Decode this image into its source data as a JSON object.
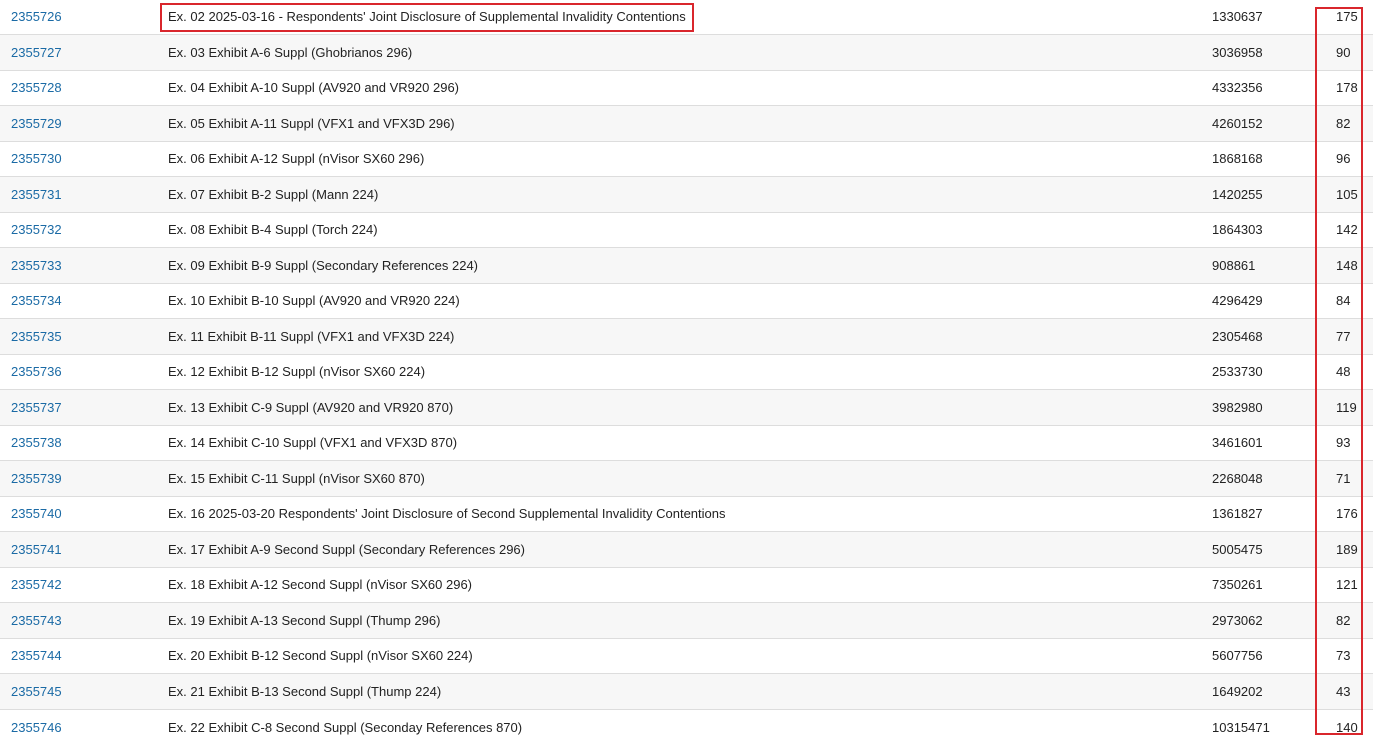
{
  "table": {
    "rows": [
      {
        "id": "2355726",
        "description": "Ex. 02 2025-03-16 - Respondents' Joint Disclosure of Supplemental Invalidity Contentions",
        "size": "1330637",
        "pages": "175"
      },
      {
        "id": "2355727",
        "description": "Ex. 03 Exhibit A-6 Suppl (Ghobrianos 296)",
        "size": "3036958",
        "pages": "90"
      },
      {
        "id": "2355728",
        "description": "Ex. 04 Exhibit A-10 Suppl (AV920 and VR920 296)",
        "size": "4332356",
        "pages": "178"
      },
      {
        "id": "2355729",
        "description": "Ex. 05 Exhibit A-11 Suppl (VFX1 and VFX3D 296)",
        "size": "4260152",
        "pages": "82"
      },
      {
        "id": "2355730",
        "description": "Ex. 06 Exhibit A-12 Suppl (nVisor SX60 296)",
        "size": "1868168",
        "pages": "96"
      },
      {
        "id": "2355731",
        "description": "Ex. 07 Exhibit B-2 Suppl (Mann 224)",
        "size": "1420255",
        "pages": "105"
      },
      {
        "id": "2355732",
        "description": "Ex. 08 Exhibit B-4 Suppl (Torch 224)",
        "size": "1864303",
        "pages": "142"
      },
      {
        "id": "2355733",
        "description": "Ex. 09 Exhibit B-9 Suppl (Secondary References 224)",
        "size": "908861",
        "pages": "148"
      },
      {
        "id": "2355734",
        "description": "Ex. 10 Exhibit B-10 Suppl (AV920 and VR920 224)",
        "size": "4296429",
        "pages": "84"
      },
      {
        "id": "2355735",
        "description": "Ex. 11 Exhibit B-11 Suppl (VFX1 and VFX3D 224)",
        "size": "2305468",
        "pages": "77"
      },
      {
        "id": "2355736",
        "description": "Ex. 12 Exhibit B-12 Suppl (nVisor SX60 224)",
        "size": "2533730",
        "pages": "48"
      },
      {
        "id": "2355737",
        "description": "Ex. 13 Exhibit C-9 Suppl (AV920 and VR920 870)",
        "size": "3982980",
        "pages": "119"
      },
      {
        "id": "2355738",
        "description": "Ex. 14 Exhibit C-10 Suppl (VFX1 and VFX3D 870)",
        "size": "3461601",
        "pages": "93"
      },
      {
        "id": "2355739",
        "description": "Ex. 15 Exhibit C-11 Suppl (nVisor SX60 870)",
        "size": "2268048",
        "pages": "71"
      },
      {
        "id": "2355740",
        "description": "Ex. 16 2025-03-20 Respondents' Joint Disclosure of Second Supplemental Invalidity Contentions",
        "size": "1361827",
        "pages": "176"
      },
      {
        "id": "2355741",
        "description": "Ex. 17 Exhibit A-9 Second Suppl (Secondary References 296)",
        "size": "5005475",
        "pages": "189"
      },
      {
        "id": "2355742",
        "description": "Ex. 18 Exhibit A-12 Second Suppl (nVisor SX60 296)",
        "size": "7350261",
        "pages": "121"
      },
      {
        "id": "2355743",
        "description": "Ex. 19 Exhibit A-13 Second Suppl (Thump 296)",
        "size": "2973062",
        "pages": "82"
      },
      {
        "id": "2355744",
        "description": "Ex. 20 Exhibit B-12 Second Suppl (nVisor SX60 224)",
        "size": "5607756",
        "pages": "73"
      },
      {
        "id": "2355745",
        "description": "Ex. 21 Exhibit B-13 Second Suppl (Thump 224)",
        "size": "1649202",
        "pages": "43"
      },
      {
        "id": "2355746",
        "description": "Ex. 22 Exhibit C-8 Second Suppl (Seconday References 870)",
        "size": "10315471",
        "pages": "140"
      }
    ]
  },
  "highlights": {
    "color": "#d9262c"
  },
  "colors": {
    "link": "#1a6aa5",
    "row_stripe": "#f7f7f7",
    "row_border": "#dddddd"
  }
}
